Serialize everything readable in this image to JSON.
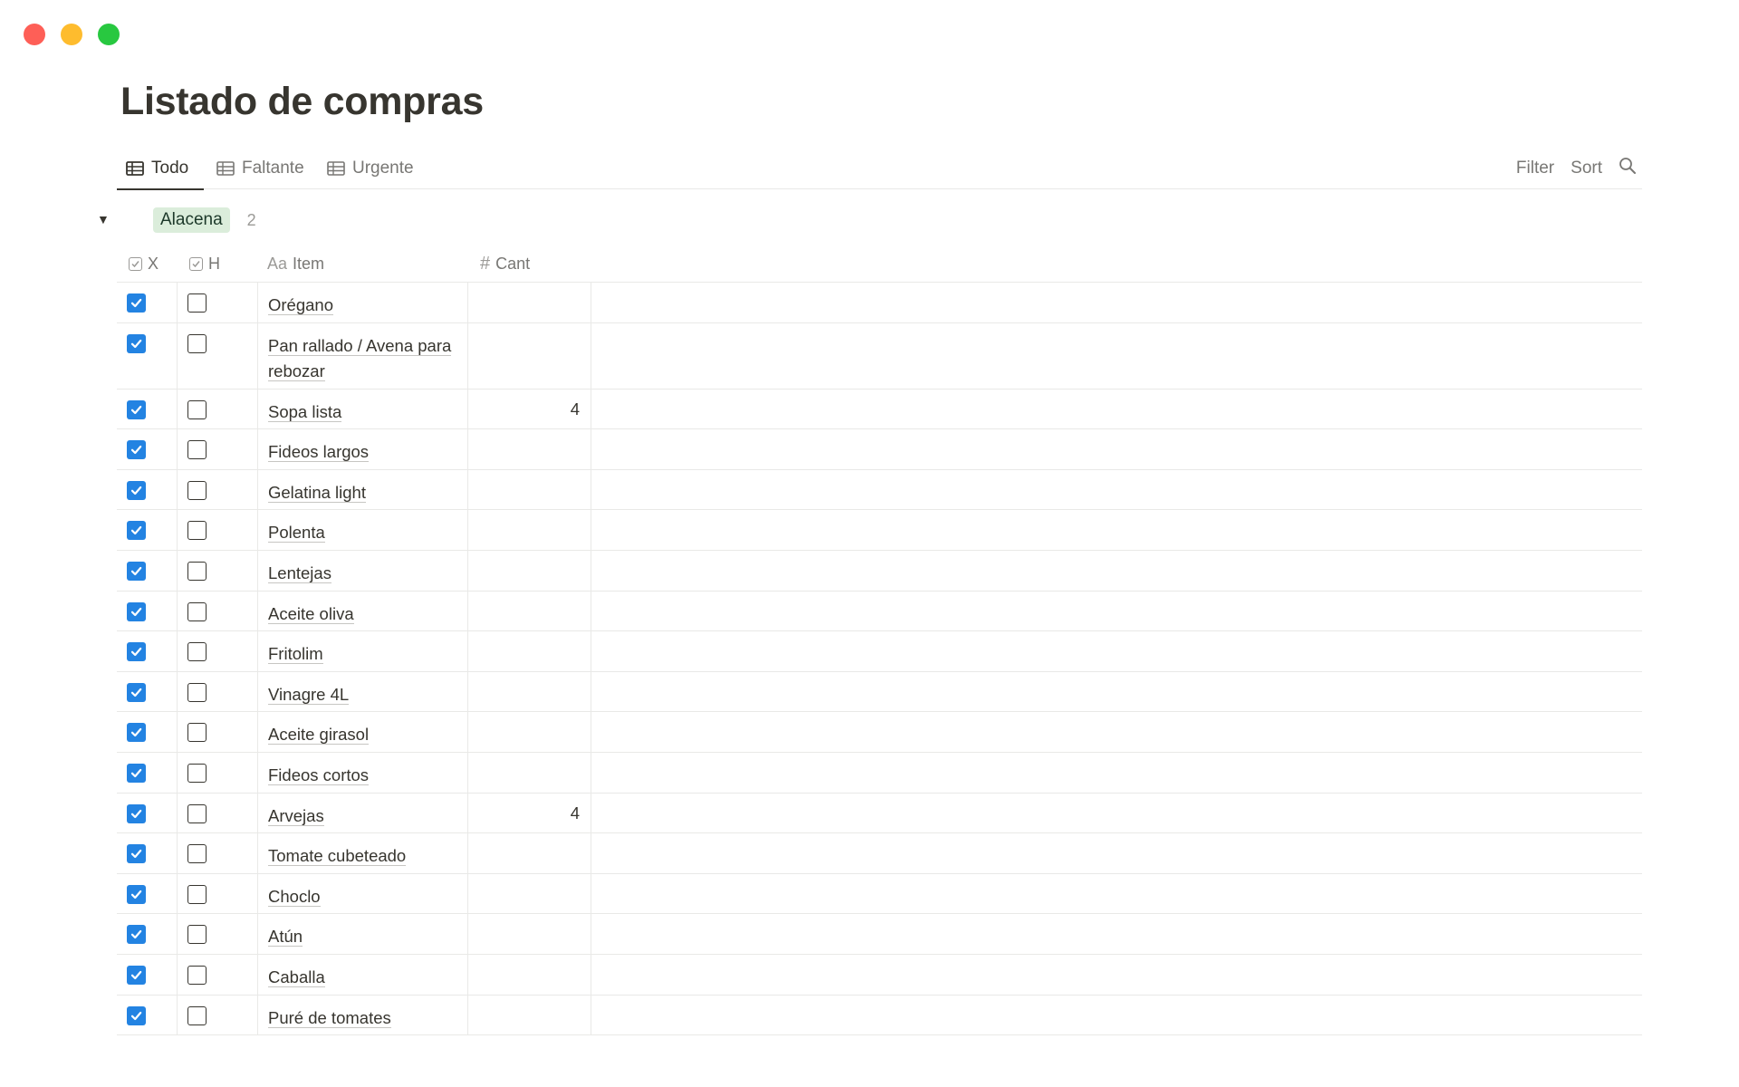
{
  "page": {
    "title": "Listado de compras"
  },
  "tabs": [
    {
      "label": "Todo",
      "icon": "table-icon",
      "active": true
    },
    {
      "label": "Faltante",
      "icon": "table-icon",
      "active": false
    },
    {
      "label": "Urgente",
      "icon": "table-icon",
      "active": false
    }
  ],
  "tools": {
    "filter": "Filter",
    "sort": "Sort",
    "search_icon": "search-icon"
  },
  "group": {
    "label": "Alacena",
    "count": "2",
    "tag_color": "#dbeddb"
  },
  "columns": {
    "x": "X",
    "h": "H",
    "item_prefix": "Aa",
    "item": "Item",
    "cant_prefix": "#",
    "cant": "Cant"
  },
  "rows": [
    {
      "item": "Orégano",
      "x": true,
      "h": false,
      "cant": ""
    },
    {
      "item": "Pan rallado / Avena para rebozar",
      "x": true,
      "h": false,
      "cant": ""
    },
    {
      "item": "Sopa lista",
      "x": true,
      "h": false,
      "cant": "4"
    },
    {
      "item": "Fideos largos",
      "x": true,
      "h": false,
      "cant": ""
    },
    {
      "item": "Gelatina light",
      "x": true,
      "h": false,
      "cant": ""
    },
    {
      "item": "Polenta",
      "x": true,
      "h": false,
      "cant": ""
    },
    {
      "item": "Lentejas",
      "x": true,
      "h": false,
      "cant": ""
    },
    {
      "item": "Aceite oliva",
      "x": true,
      "h": false,
      "cant": ""
    },
    {
      "item": "Fritolim",
      "x": true,
      "h": false,
      "cant": ""
    },
    {
      "item": "Vinagre 4L",
      "x": true,
      "h": false,
      "cant": ""
    },
    {
      "item": "Aceite girasol",
      "x": true,
      "h": false,
      "cant": ""
    },
    {
      "item": "Fideos cortos",
      "x": true,
      "h": false,
      "cant": ""
    },
    {
      "item": "Arvejas",
      "x": true,
      "h": false,
      "cant": "4"
    },
    {
      "item": "Tomate cubeteado",
      "x": true,
      "h": false,
      "cant": ""
    },
    {
      "item": "Choclo",
      "x": true,
      "h": false,
      "cant": ""
    },
    {
      "item": "Atún",
      "x": true,
      "h": false,
      "cant": ""
    },
    {
      "item": "Caballa",
      "x": true,
      "h": false,
      "cant": ""
    },
    {
      "item": "Puré de tomates",
      "x": true,
      "h": false,
      "cant": ""
    }
  ],
  "colors": {
    "checked": "#2383e2",
    "text": "#37352f",
    "muted": "#787774",
    "border": "#e9e9e7"
  }
}
